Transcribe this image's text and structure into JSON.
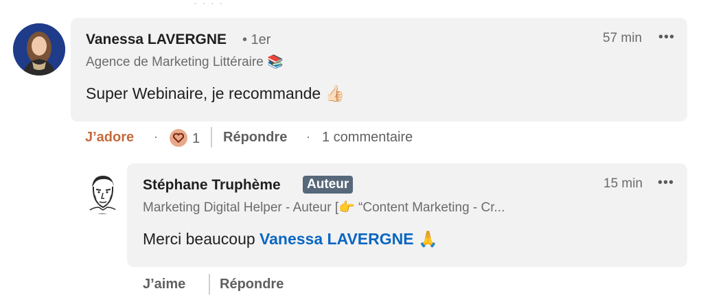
{
  "comment": {
    "author_name": "Vanessa LAVERGNE",
    "degree": "• 1er",
    "headline": "Agence de Marketing Littéraire 📚",
    "text": "Super Webinaire, je recommande 👍🏻",
    "time": "57 min",
    "more_icon": "•••",
    "actions": {
      "like_label": "J’adore",
      "dot": "·",
      "reaction_icon": "heart-reaction-icon",
      "reaction_count": "1",
      "reply_label": "Répondre",
      "dot2": "·",
      "comments_label": "1 commentaire"
    }
  },
  "reply": {
    "author_name": "Stéphane Truphème",
    "badge": "Auteur",
    "headline": "Marketing Digital Helper - Auteur [👉 “Content Marketing - Cr...",
    "text_prefix": "Merci beaucoup ",
    "mention": "Vanessa LAVERGNE",
    "text_suffix": " 🙏",
    "time": "15 min",
    "more_icon": "•••",
    "actions": {
      "like_label": "J’aime",
      "reply_label": "Répondre"
    }
  },
  "colors": {
    "bubble": "#f2f2f2",
    "liked": "#c46a3c",
    "mention": "#0a66c2",
    "badge": "#56687a"
  }
}
